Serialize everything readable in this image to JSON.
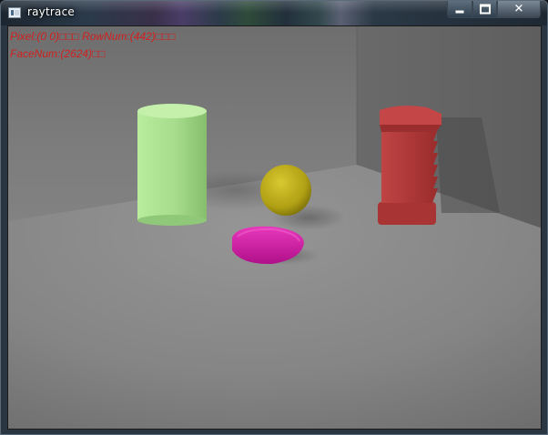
{
  "window": {
    "title": "raytrace",
    "controls": {
      "minimize": "minimize-button",
      "maximize": "maximize-button",
      "close": "close-button"
    }
  },
  "overlay": {
    "line1": "Pixel:(0 0)□□□ RowNum:(442)□□□",
    "line2": "FaceNum:(2624)□□"
  },
  "scene": {
    "objects": [
      {
        "name": "cylinder",
        "color": "#a8e090"
      },
      {
        "name": "sphere",
        "color": "#c8b820"
      },
      {
        "name": "rounded-box",
        "color": "#d020a8"
      },
      {
        "name": "stacked-tower",
        "color": "#b03838"
      }
    ],
    "colors": {
      "overlay_text": "#d02020",
      "wall_back": "#7a7a7a",
      "wall_right": "#6a6a6a",
      "floor": "#8a8a8a"
    }
  }
}
